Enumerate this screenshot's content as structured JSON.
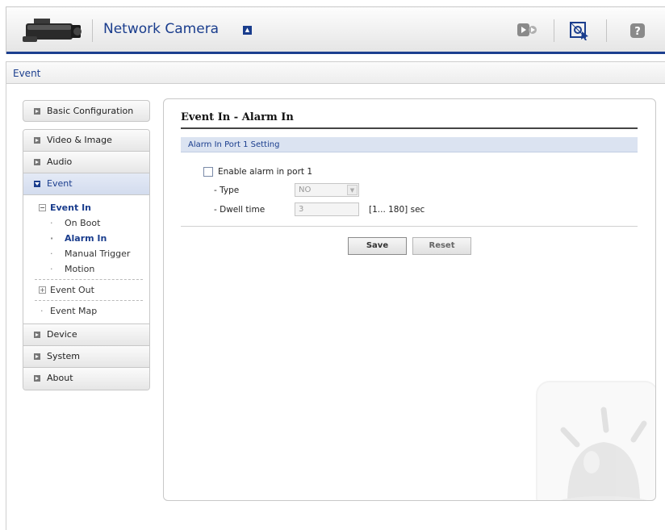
{
  "header": {
    "title": "Network Camera",
    "icons": [
      "camera-logo",
      "live-view-icon",
      "setup-icon",
      "help-icon"
    ]
  },
  "breadcrumb": "Event",
  "sidebar": {
    "basic_config": "Basic Configuration",
    "items": [
      {
        "label": "Video & Image"
      },
      {
        "label": "Audio"
      },
      {
        "label": "Event",
        "active": true
      }
    ],
    "event_sub": {
      "event_in": "Event In",
      "on_boot": "On Boot",
      "alarm_in": "Alarm In",
      "manual_trigger": "Manual Trigger",
      "motion": "Motion",
      "event_out": "Event Out",
      "event_map": "Event Map"
    },
    "bottom_items": [
      {
        "label": "Device"
      },
      {
        "label": "System"
      },
      {
        "label": "About"
      }
    ]
  },
  "main": {
    "title": "Event In - Alarm In",
    "section": "Alarm In Port 1 Setting",
    "enable_label": "Enable alarm in port 1",
    "enable_checked": false,
    "type_label": "- Type",
    "type_value": "NO",
    "dwell_label": "- Dwell time",
    "dwell_value": "3",
    "dwell_range": "[1... 180] sec",
    "save_label": "Save",
    "reset_label": "Reset"
  },
  "colors": {
    "accent": "#1a3d8d",
    "section_bg": "#dbe3f1"
  }
}
